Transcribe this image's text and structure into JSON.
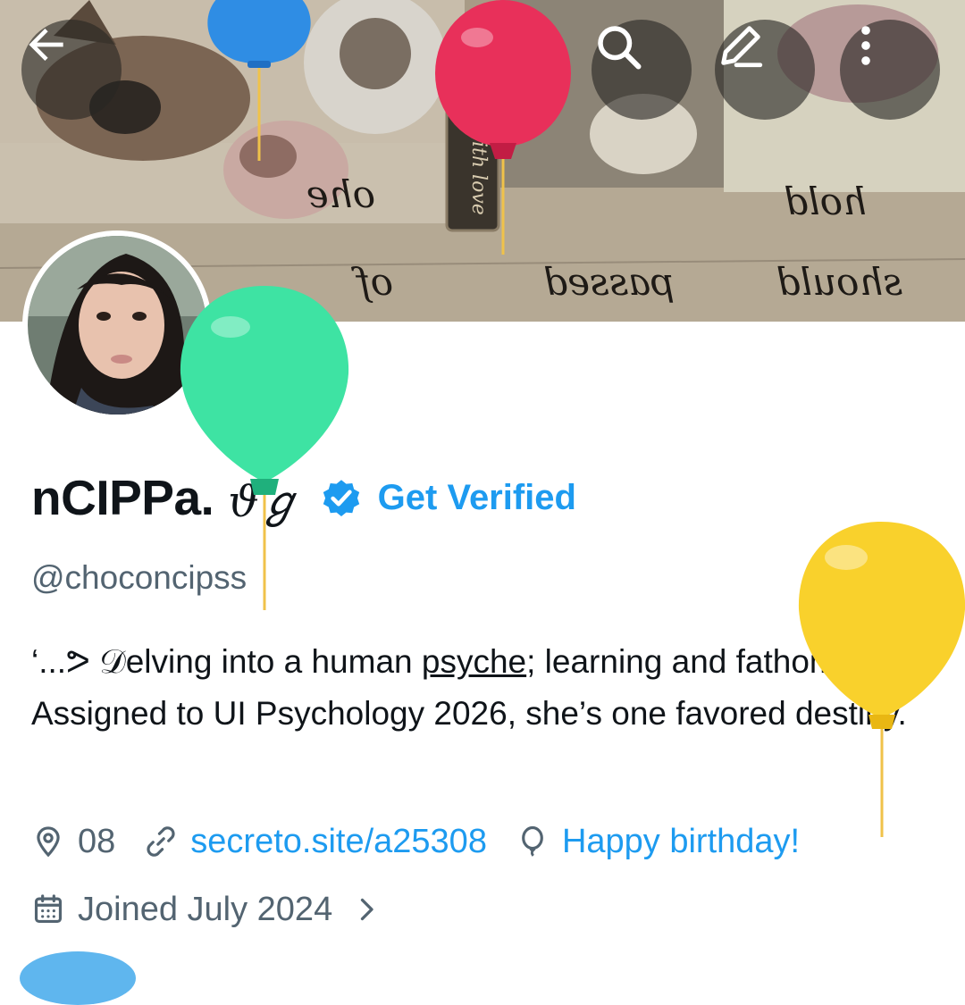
{
  "header": {
    "back_icon": "arrow-left-icon",
    "actions": [
      "search-icon",
      "edit-icon",
      "more-vertical-icon"
    ]
  },
  "profile": {
    "display_name": "nCIPPa.",
    "name_emoji": "ϑℊ",
    "verified": true,
    "get_verified_label": "Get Verified",
    "handle": "@choconcipss",
    "bio_prefix": "‘...ᕗ 𝒟elving into a human ",
    "bio_underlined": "psyche",
    "bio_suffix": "; learning and fathomed. Assigned to UI Psychology 2026, she’s one favored destiny.",
    "location": "08",
    "website": "secreto.site/a25308",
    "birthday": "Happy birthday!",
    "joined": "Joined July 2024"
  },
  "banner_text": {
    "tag": "with love",
    "script_1": "ohe",
    "script_2": "of",
    "script_3": "passed",
    "script_4": "should",
    "script_5": "hold"
  },
  "colors": {
    "accent": "#1d9bf0",
    "muted": "#536471",
    "text": "#0f1419",
    "balloon_blue": "#2f8de4",
    "balloon_red": "#e8305a",
    "balloon_green": "#3ee3a3",
    "balloon_yellow": "#f9d12c"
  }
}
